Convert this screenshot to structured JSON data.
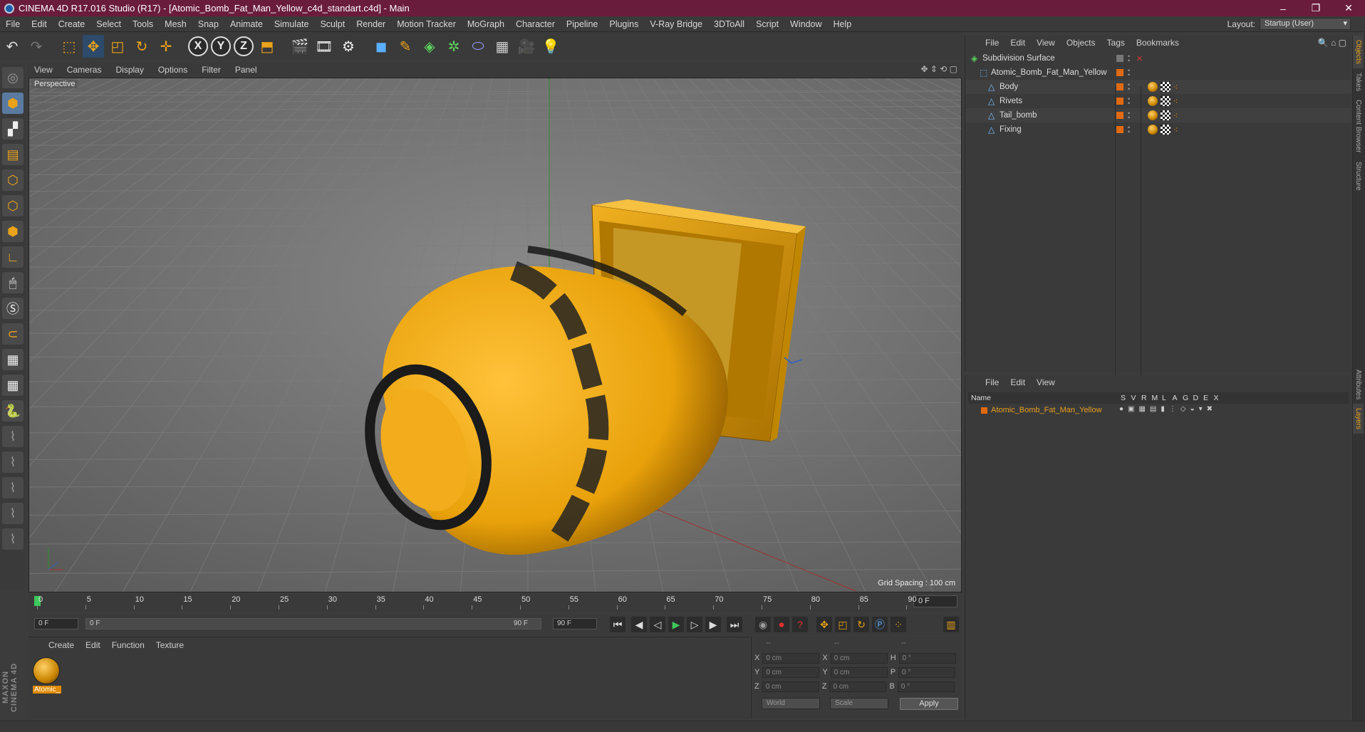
{
  "window": {
    "title": "CINEMA 4D R17.016 Studio (R17) - [Atomic_Bomb_Fat_Man_Yellow_c4d_standart.c4d] - Main",
    "controls": [
      "–",
      "❐",
      "✕"
    ]
  },
  "menubar": {
    "items": [
      "File",
      "Edit",
      "Create",
      "Select",
      "Tools",
      "Mesh",
      "Snap",
      "Animate",
      "Simulate",
      "Sculpt",
      "Render",
      "Motion Tracker",
      "MoGraph",
      "Character",
      "Pipeline",
      "Plugins",
      "V-Ray Bridge",
      "3DToAll",
      "Script",
      "Window",
      "Help"
    ],
    "layout_label": "Layout:",
    "layout_value": "Startup (User)"
  },
  "viewport": {
    "menu": [
      "View",
      "Cameras",
      "Display",
      "Options",
      "Filter",
      "Panel"
    ],
    "label": "Perspective",
    "grid_spacing": "Grid Spacing : 100 cm"
  },
  "timeline": {
    "ticks": [
      "0",
      "5",
      "10",
      "15",
      "20",
      "25",
      "30",
      "35",
      "40",
      "45",
      "50",
      "55",
      "60",
      "65",
      "70",
      "75",
      "80",
      "85",
      "90"
    ],
    "current_frame": "0 F",
    "start_field": "0 F",
    "range_start": "0 F",
    "range_end": "90 F",
    "end_field": "90 F"
  },
  "material_manager": {
    "menu": [
      "Create",
      "Edit",
      "Function",
      "Texture"
    ],
    "materials": [
      {
        "name": "Atomic_"
      }
    ]
  },
  "coordinates": {
    "header": [
      "--",
      "--",
      "--"
    ],
    "rows": [
      {
        "axis1": "X",
        "val1": "0 cm",
        "axis2": "X",
        "val2": "0 cm",
        "axis3": "H",
        "val3": "0 °"
      },
      {
        "axis1": "Y",
        "val1": "0 cm",
        "axis2": "Y",
        "val2": "0 cm",
        "axis3": "P",
        "val3": "0 °"
      },
      {
        "axis1": "Z",
        "val1": "0 cm",
        "axis2": "Z",
        "val2": "0 cm",
        "axis3": "B",
        "val3": "0 °"
      }
    ],
    "mode": "World",
    "scale": "Scale",
    "apply": "Apply"
  },
  "object_manager": {
    "menu": [
      "File",
      "Edit",
      "View",
      "Objects",
      "Tags",
      "Bookmarks"
    ],
    "objects": [
      {
        "name": "Subdivision Surface",
        "indent": 0
      },
      {
        "name": "Atomic_Bomb_Fat_Man_Yellow",
        "indent": 1
      },
      {
        "name": "Body",
        "indent": 2
      },
      {
        "name": "Rivets",
        "indent": 2
      },
      {
        "name": "Tail_bomb",
        "indent": 2
      },
      {
        "name": "Fixing",
        "indent": 2
      }
    ]
  },
  "layer_manager": {
    "menu": [
      "File",
      "Edit",
      "View"
    ],
    "columns": [
      "Name",
      "S",
      "V",
      "R",
      "M",
      "L",
      "A",
      "G",
      "D",
      "E",
      "X"
    ],
    "layers": [
      {
        "name": "Atomic_Bomb_Fat_Man_Yellow"
      }
    ]
  },
  "side_tabs": [
    "Objects",
    "Takes",
    "Content Browser",
    "Structure",
    "Attributes",
    "Layers"
  ],
  "brand": "MAXON CINEMA 4D",
  "colors": {
    "accent": "#e9a21a",
    "titlebar": "#6a1c3c",
    "layer": "#e06a10"
  }
}
